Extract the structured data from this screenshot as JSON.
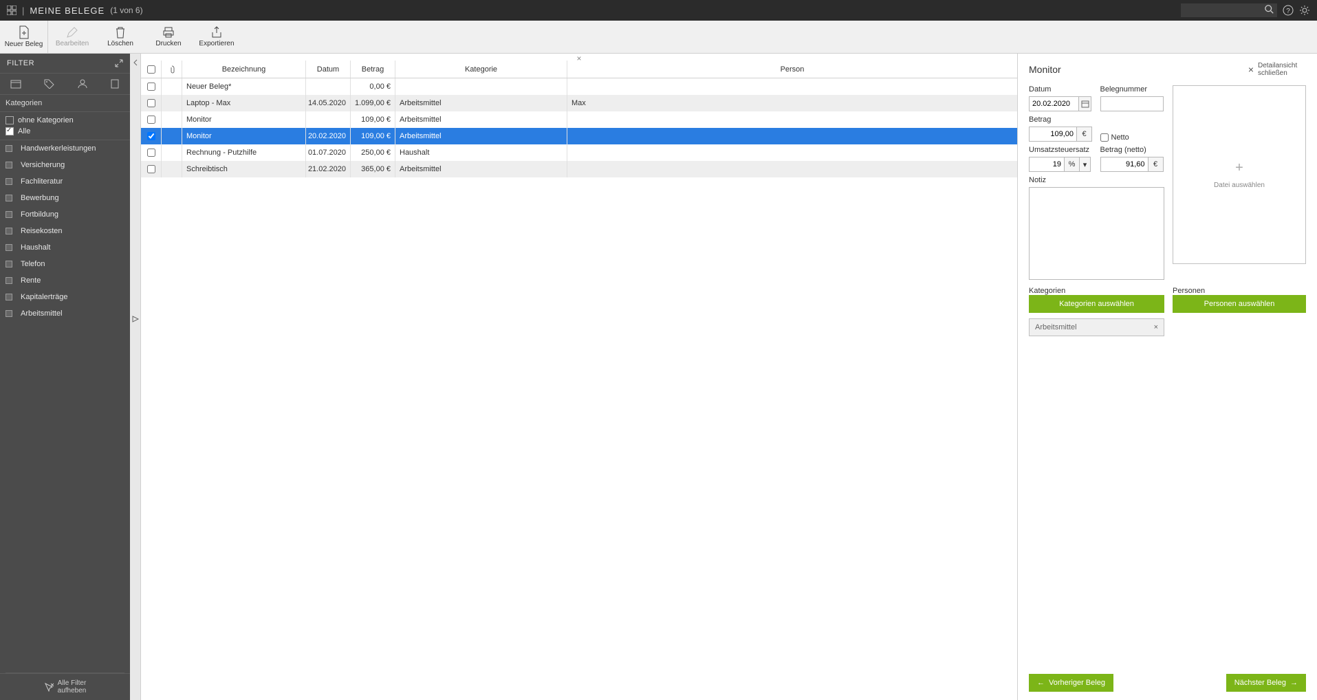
{
  "topbar": {
    "title": "MEINE BELEGE",
    "count_text": "(1 von 6)"
  },
  "toolbar": {
    "new_label": "Neuer Beleg",
    "edit_label": "Bearbeiten",
    "delete_label": "Löschen",
    "print_label": "Drucken",
    "export_label": "Exportieren"
  },
  "sidebar": {
    "filter_title": "FILTER",
    "section_categories": "Kategorien",
    "no_categories": "ohne Kategorien",
    "all": "Alle",
    "items": [
      "Handwerkerleistungen",
      "Versicherung",
      "Fachliteratur",
      "Bewerbung",
      "Fortbildung",
      "Reisekosten",
      "Haushalt",
      "Telefon",
      "Rente",
      "Kapitalerträge",
      "Arbeitsmittel"
    ],
    "clear_line1": "Alle Filter",
    "clear_line2": "aufheben"
  },
  "table": {
    "headers": {
      "name": "Bezeichnung",
      "date": "Datum",
      "amount": "Betrag",
      "category": "Kategorie",
      "person": "Person"
    },
    "rows": [
      {
        "name": "Neuer Beleg*",
        "date": "",
        "amount": "0,00 €",
        "category": "",
        "person": "",
        "checked": false,
        "selected": false
      },
      {
        "name": "Laptop - Max",
        "date": "14.05.2020",
        "amount": "1.099,00 €",
        "category": "Arbeitsmittel",
        "person": "Max",
        "checked": false,
        "selected": false
      },
      {
        "name": "Monitor",
        "date": "",
        "amount": "109,00 €",
        "category": "Arbeitsmittel",
        "person": "",
        "checked": false,
        "selected": false
      },
      {
        "name": "Monitor",
        "date": "20.02.2020",
        "amount": "109,00 €",
        "category": "Arbeitsmittel",
        "person": "",
        "checked": true,
        "selected": true
      },
      {
        "name": "Rechnung  - Putzhilfe",
        "date": "01.07.2020",
        "amount": "250,00 €",
        "category": "Haushalt",
        "person": "",
        "checked": false,
        "selected": false
      },
      {
        "name": "Schreibtisch",
        "date": "21.02.2020",
        "amount": "365,00 €",
        "category": "Arbeitsmittel",
        "person": "",
        "checked": false,
        "selected": false
      }
    ]
  },
  "detail": {
    "title": "Monitor",
    "close_label": "Detailansicht schließen",
    "labels": {
      "date": "Datum",
      "receipt_no": "Belegnummer",
      "amount": "Betrag",
      "netto": "Netto",
      "vat_rate": "Umsatzsteuersatz",
      "amount_net": "Betrag (netto)",
      "note": "Notiz",
      "categories": "Kategorien",
      "persons": "Personen",
      "drop_hint": "Datei auswählen"
    },
    "values": {
      "date": "20.02.2020",
      "receipt_no": "",
      "amount": "109,00",
      "vat_rate": "19",
      "amount_net": "91,60",
      "note": ""
    },
    "buttons": {
      "select_categories": "Kategorien auswählen",
      "select_persons": "Personen auswählen",
      "prev": "Vorheriger Beleg",
      "next": "Nächster Beleg"
    },
    "tags": {
      "category": "Arbeitsmittel"
    }
  }
}
